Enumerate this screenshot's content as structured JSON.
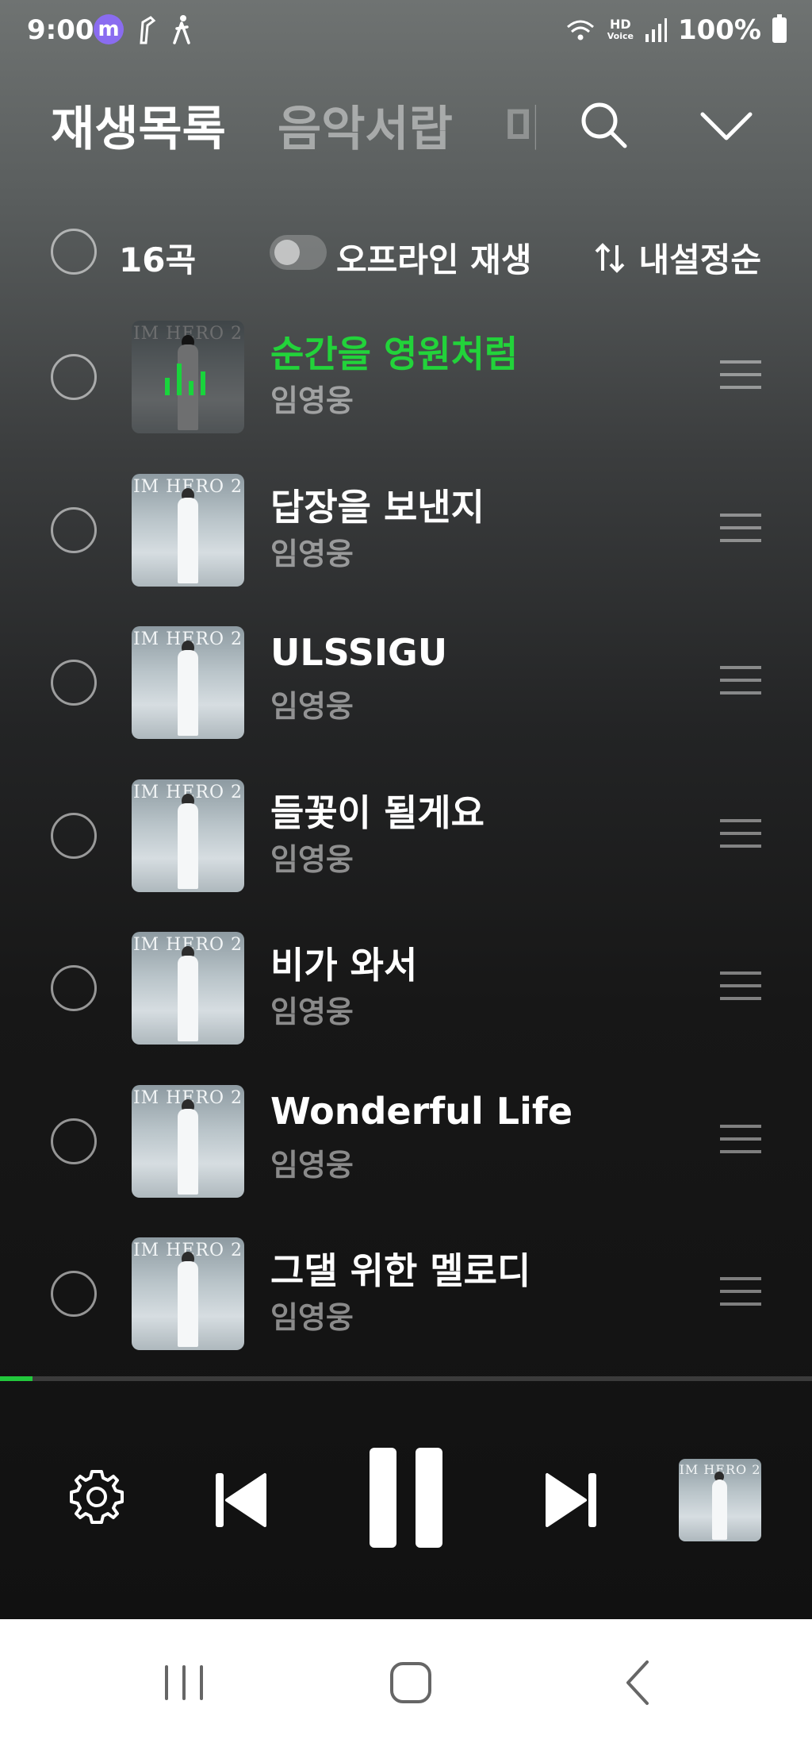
{
  "status_bar": {
    "time": "9:00",
    "app_badge": "m",
    "hd_label": "HD",
    "voice_label": "Voice",
    "battery": "100%"
  },
  "header": {
    "tabs": [
      {
        "label": "재생목록",
        "active": true
      },
      {
        "label": "음악서랍",
        "active": false
      },
      {
        "label": "마",
        "active": false
      }
    ]
  },
  "toolbar": {
    "count": "16곡",
    "offline_label": "오프라인 재생",
    "offline_enabled": false,
    "sort_label": "내설정순"
  },
  "tracks": [
    {
      "title": "순간을 영원처럼",
      "artist": "임영웅",
      "playing": true
    },
    {
      "title": "답장을 보낸지",
      "artist": "임영웅",
      "playing": false
    },
    {
      "title": "ULSSIGU",
      "artist": "임영웅",
      "playing": false
    },
    {
      "title": "들꽃이 될게요",
      "artist": "임영웅",
      "playing": false
    },
    {
      "title": "비가 와서",
      "artist": "임영웅",
      "playing": false
    },
    {
      "title": "Wonderful Life",
      "artist": "임영웅",
      "playing": false
    },
    {
      "title": "그댈 위한 멜로디",
      "artist": "임영웅",
      "playing": false
    }
  ],
  "album_cover_text": "IM HERO 2",
  "player": {
    "progress": 0.04,
    "state": "playing"
  },
  "colors": {
    "accent": "#22d33a"
  }
}
